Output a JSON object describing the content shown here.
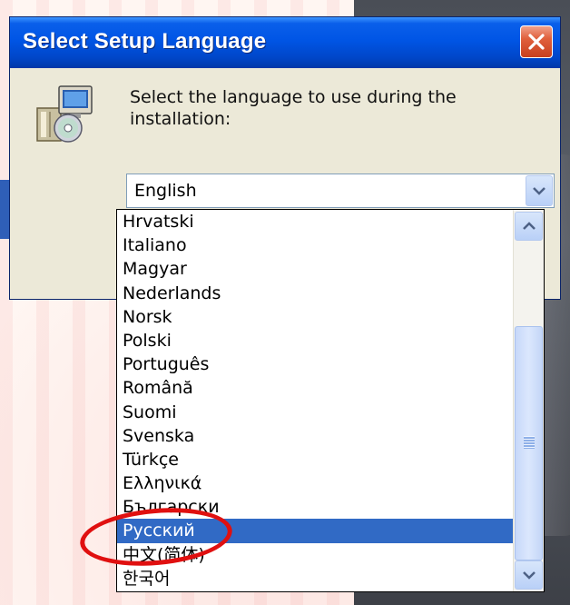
{
  "window": {
    "title": "Select Setup Language",
    "prompt": "Select the language to use during the installation:",
    "close_icon": "close-icon",
    "setup_icon": "setup-installer-icon"
  },
  "combo": {
    "selected_value": "English",
    "button_icon": "chevron-down-icon"
  },
  "dropdown": {
    "items": [
      "Hrvatski",
      "Italiano",
      "Magyar",
      "Nederlands",
      "Norsk",
      "Polski",
      "Português",
      "Română",
      "Suomi",
      "Svenska",
      "Türkçe",
      "Ελληνικά",
      "Български",
      "Русский",
      "中文(简体)",
      "한국어"
    ],
    "highlighted": "Русский"
  },
  "colors": {
    "title_bar": "#0055e5",
    "selection": "#316ac5",
    "annotation": "#e01010",
    "dialog_bg": "#ece9d8"
  }
}
